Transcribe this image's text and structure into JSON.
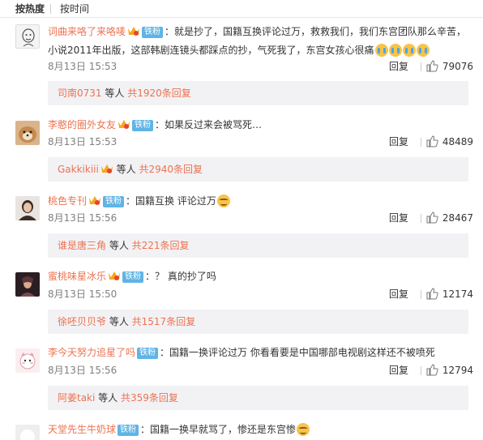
{
  "sort_tabs": {
    "hot": "按热度",
    "time": "按时间"
  },
  "colors": {
    "username": "#eb7350",
    "fan_badge": "#5fb4e6",
    "reply_box_bg": "#f2f2f5",
    "emoji": "#f7c34a"
  },
  "reply_label": "回复",
  "comments": [
    {
      "user": "词曲来咯了来咯唛",
      "badge": "铁粉",
      "text_line1": "：就是抄了，国籍互换评论过万，救救我们，我们东宫团队那么辛苦，",
      "text_line2": "小说2011年出版，这部韩剧连镜头都踩点的抄，气死我了，东宫女孩心很痛",
      "emoji": "cry-face-icon",
      "time": "8月13日 15:53",
      "likes": "79076",
      "reply_user": "司南0731",
      "reply_mid": " 等人 ",
      "reply_count": "共1920条回复"
    },
    {
      "user": "李憨的圈外女友",
      "badge": "铁粉",
      "text": "：如果反过来会被骂死…",
      "time": "8月13日 15:53",
      "likes": "48489",
      "reply_user": "Gakkikiii",
      "reply_mid": " 等人 ",
      "reply_count": "共2940条回复"
    },
    {
      "user": "桃色专刊",
      "badge": "铁粉",
      "text": "：国籍互换 评论过万",
      "emoji": "smile-face-icon",
      "time": "8月13日 15:56",
      "likes": "28467",
      "reply_user": "谁是唐三角",
      "reply_mid": " 等人 ",
      "reply_count": "共221条回复"
    },
    {
      "user": "蜜桃味星冰乐",
      "badge": "铁粉",
      "text": "：？ 真的抄了吗",
      "time": "8月13日 15:50",
      "likes": "12174",
      "reply_user": "徐呸贝贝爷",
      "reply_mid": " 等人 ",
      "reply_count": "共1517条回复"
    },
    {
      "user": "李今天努力追星了吗",
      "badge": "铁粉",
      "text": "：国籍一换评论过万 你看看要是中国哪部电视剧这样还不被喷死",
      "time": "8月13日 15:56",
      "likes": "12794",
      "reply_user": "阿姜taki",
      "reply_mid": " 等人 ",
      "reply_count": "共359条回复"
    },
    {
      "user": "天堂先生牛奶球",
      "badge": "铁粉",
      "text": "：国籍一换早就骂了，惨还是东宫惨",
      "emoji": "smile-face-icon"
    }
  ]
}
